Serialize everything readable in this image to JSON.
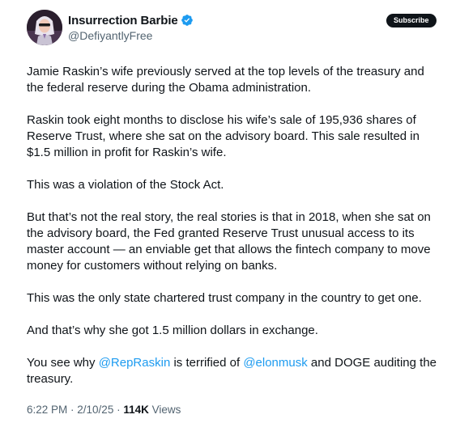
{
  "author": {
    "display_name": "Insurrection Barbie",
    "handle": "@DefiyantlyFree",
    "verified_badge_color": "#1d9bf0"
  },
  "actions": {
    "subscribe_label": "Subscribe"
  },
  "tweet": {
    "paragraphs": [
      "Jamie Raskin’s wife previously served at the top levels of the treasury and the federal reserve during the Obama administration.",
      "Raskin took eight months to disclose his wife’s sale of 195,936 shares of Reserve Trust, where she sat on the advisory board. This sale resulted in $1.5 million in profit for Raskin’s wife.",
      "This was a violation of the Stock Act.",
      "But that’s not the real story, the real stories is that in 2018, when she sat on the advisory board, the Fed granted Reserve Trust unusual access to its master account — an enviable get that allows the fintech company to move money for customers without relying on banks.",
      "This was the only state chartered trust company in the country to get one.",
      "And that’s why she got 1.5 million dollars in exchange."
    ],
    "last_paragraph": {
      "part1": "You see why ",
      "mention1": "@RepRaskin",
      "part2": " is terrified of ",
      "mention2": "@elonmusk",
      "part3": " and DOGE auditing the treasury."
    }
  },
  "meta": {
    "time": "6:22 PM",
    "separator": " · ",
    "date": "2/10/25",
    "views_count": "114K",
    "views_label": " Views"
  },
  "colors": {
    "mention": "#1d9bf0",
    "secondary_text": "#536471",
    "primary_text": "#0f1419"
  }
}
